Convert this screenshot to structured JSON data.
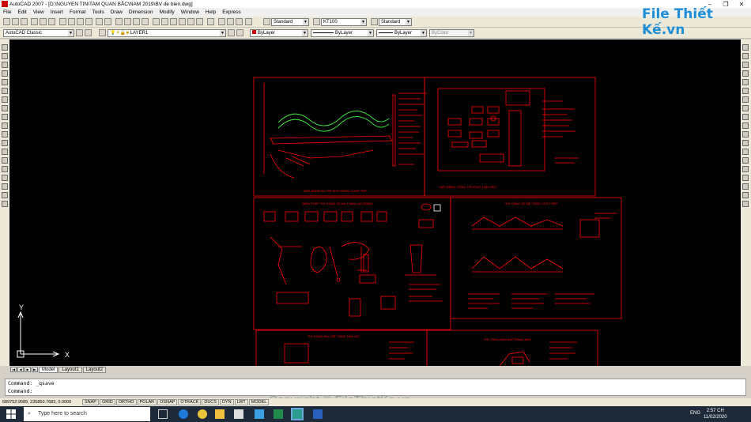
{
  "window": {
    "title": "AutoCAD 2007 - [D:\\NGUYEN TIN\\TAM QUAN BẮC\\NAM 2019\\BV de bien.dwg]",
    "controls": [
      "–",
      "❐",
      "✕"
    ]
  },
  "menu": [
    "File",
    "Edit",
    "View",
    "Insert",
    "Format",
    "Tools",
    "Draw",
    "Dimension",
    "Modify",
    "Window",
    "Help",
    "Express"
  ],
  "toolbar1": {
    "text_style": "Standard",
    "dim_style": "KT100",
    "table_style": "Standard"
  },
  "toolbar2": {
    "workspace": "AutoCAD Classic",
    "layer": "LAYER1",
    "color": "ByLayer",
    "linetype": "ByLayer",
    "lineweight": "ByLayer",
    "plotstyle": "ByColor"
  },
  "logo": "File Thiết Kế.vn",
  "drawing": {
    "ucs_x": "X",
    "ucs_y": "Y",
    "titles": [
      "MẶT BẰNG BỐ TRÍ KHO ĐÔNG TỔNG THỂ",
      "MẶT BẰNG CÔNG TRƯỜNG LÀM VIỆC",
      "BIỆN PHÁP THI CÔNG VÀ AN TOÀN LAO ĐỘNG",
      "THI CÔNG KÈ BÊ TÔNG CỐT THÉP",
      "THI CÔNG ĐÚC BÊ TÔNG TẤM LÁT",
      "THI CÔNG ĐÀO ĐẤT BẰNG MÁY"
    ]
  },
  "layout_tabs": [
    "Model",
    "Layout1",
    "Layout2"
  ],
  "command_lines": [
    "Command:  _qsave",
    "Command:"
  ],
  "status": {
    "coords": "689752.9589, 235850.7683, 0.0000",
    "toggles": [
      "SNAP",
      "GRID",
      "ORTHO",
      "POLAR",
      "OSNAP",
      "OTRACK",
      "DUCS",
      "DYN",
      "LWT",
      "MODEL"
    ]
  },
  "watermark": "Copyright © FileThietKe.vn",
  "taskbar": {
    "search_placeholder": "Type here to search",
    "language": "ENG",
    "time": "2:57 CH",
    "date": "11/02/2020"
  }
}
